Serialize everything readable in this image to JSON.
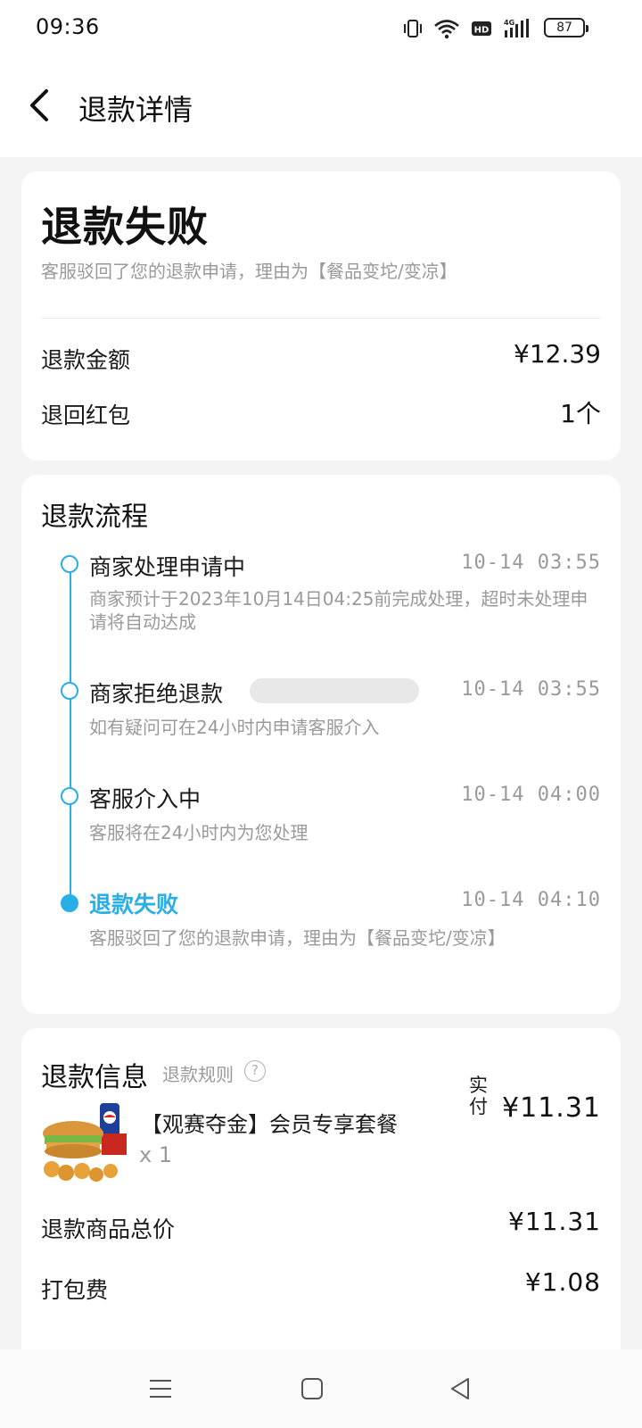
{
  "status_bar": {
    "time": "09:36",
    "battery": "87",
    "icons": [
      "vibrate-icon",
      "wifi-icon",
      "hd-icon",
      "4g-signal-icon",
      "battery-icon"
    ]
  },
  "header": {
    "title": "退款详情"
  },
  "refund_status": {
    "title": "退款失败",
    "description": "客服驳回了您的退款申请，理由为【餐品变坨/变凉】",
    "amount_label": "退款金额",
    "amount_value": "¥12.39",
    "redpacket_label": "退回红包",
    "redpacket_value": "1个"
  },
  "process": {
    "title": "退款流程",
    "steps": [
      {
        "title": "商家处理申请中",
        "time": "10-14 03:55",
        "desc": "商家预计于2023年10月14日04:25前完成处理，超时未处理申请将自动达成"
      },
      {
        "title": "商家拒绝退款",
        "time": "10-14 03:55",
        "desc": "如有疑问可在24小时内申请客服介入"
      },
      {
        "title": "客服介入中",
        "time": "10-14 04:00",
        "desc": "客服将在24小时内为您处理"
      },
      {
        "title": "退款失败",
        "time": "10-14 04:10",
        "desc": "客服驳回了您的退款申请，理由为【餐品变坨/变凉】"
      }
    ]
  },
  "refund_info": {
    "title": "退款信息",
    "rules_link": "退款规则",
    "help_symbol": "?",
    "product_name": "【观赛夺金】会员专享套餐",
    "quantity": "x  1",
    "paid_label": "实付",
    "paid_value": "¥11.31",
    "total_label": "退款商品总价",
    "total_value": "¥11.31",
    "packing_label": "打包费",
    "packing_value": "¥1.08"
  },
  "colors": {
    "accent": "#29aee6",
    "text_primary": "#1a1a1a",
    "text_secondary": "#9a9a9a",
    "background": "#f4f4f4"
  }
}
